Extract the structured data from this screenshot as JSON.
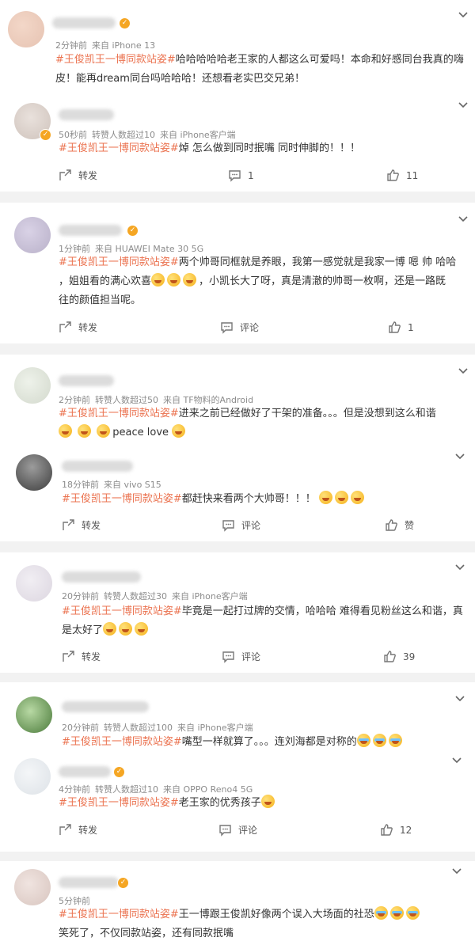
{
  "accent": "#eb7350",
  "icons": {
    "share": "share-icon",
    "comment": "comment-icon",
    "like": "thumb-up-icon",
    "more": "chevron-down-icon",
    "verified": "v-badge-icon"
  },
  "posts": [
    {
      "meta": [
        "2分钟前",
        "来自 iPhone 13"
      ],
      "hashtag": "#王俊凯王一博同款站姿#",
      "body": "哈哈哈哈哈老王家的人都这么可爱吗！本命和好感同台我真的嗨皮！能再dream同台吗哈哈哈！还想看老实巴交兄弟！"
    },
    {
      "meta": [
        "50秒前",
        "转赞人数超过10",
        "来自 iPhone客户端"
      ],
      "hashtag": "#王俊凯王一博同款站姿#",
      "body": "焯 怎么做到同时抿嘴 同时伸脚的！！！",
      "actions": {
        "share": "转发",
        "comment": "1",
        "like": "11"
      }
    },
    {
      "meta": [
        "1分钟前",
        "来自 HUAWEI Mate 30 5G"
      ],
      "hashtag": "#王俊凯王一博同款站姿#",
      "body_a": "两个帅哥同框就是养眼，我第一感觉就是我家一博 嗯 帅 哈哈",
      "body_b": "，姐姐看的满心欢喜",
      "body_c": "，小凯长大了呀，真是清澈的帅哥一枚啊，还是一路既",
      "body_d": "往的颜值担当呢。",
      "actions": {
        "share": "转发",
        "comment": "评论",
        "like": "1"
      }
    },
    {
      "meta": [
        "2分钟前",
        "转赞人数超过50",
        "来自 TF物料的Android"
      ],
      "hashtag": "#王俊凯王一博同款站姿#",
      "body": "进来之前已经做好了干架的准备。。。但是没想到这么和谐",
      "body_tail": "peace love"
    },
    {
      "meta": [
        "18分钟前",
        "来自 vivo S15"
      ],
      "hashtag": "#王俊凯王一博同款站姿#",
      "body": "都赶快来看两个大帅哥！！！",
      "actions": {
        "share": "转发",
        "comment": "评论",
        "like": "赞"
      }
    },
    {
      "meta": [
        "20分钟前",
        "转赞人数超过30",
        "来自 iPhone客户端"
      ],
      "hashtag": "#王俊凯王一博同款站姿#",
      "body_a": "毕竟是一起打过牌的交情，哈哈哈 难得看见粉丝这么和谐，真",
      "body_b": "是太好了",
      "actions": {
        "share": "转发",
        "comment": "评论",
        "like": "39"
      }
    },
    {
      "meta": [
        "20分钟前",
        "转赞人数超过100",
        "来自 iPhone客户端"
      ],
      "hashtag": "#王俊凯王一博同款站姿#",
      "body": "嘴型一样就算了。。。连刘海都是对称的"
    },
    {
      "meta": [
        "4分钟前",
        "转赞人数超过10",
        "来自 OPPO Reno4 5G"
      ],
      "hashtag": "#王俊凯王一博同款站姿#",
      "body": "老王家的优秀孩子",
      "actions": {
        "share": "转发",
        "comment": "评论",
        "like": "12"
      }
    },
    {
      "meta": [
        "5分钟前"
      ],
      "hashtag": "#王俊凯王一博同款站姿#",
      "body_a": "王一博跟王俊凯好像两个误入大场面的社恐",
      "body_b": "笑死了，不仅同款站姿，还有同款抿嘴"
    }
  ]
}
